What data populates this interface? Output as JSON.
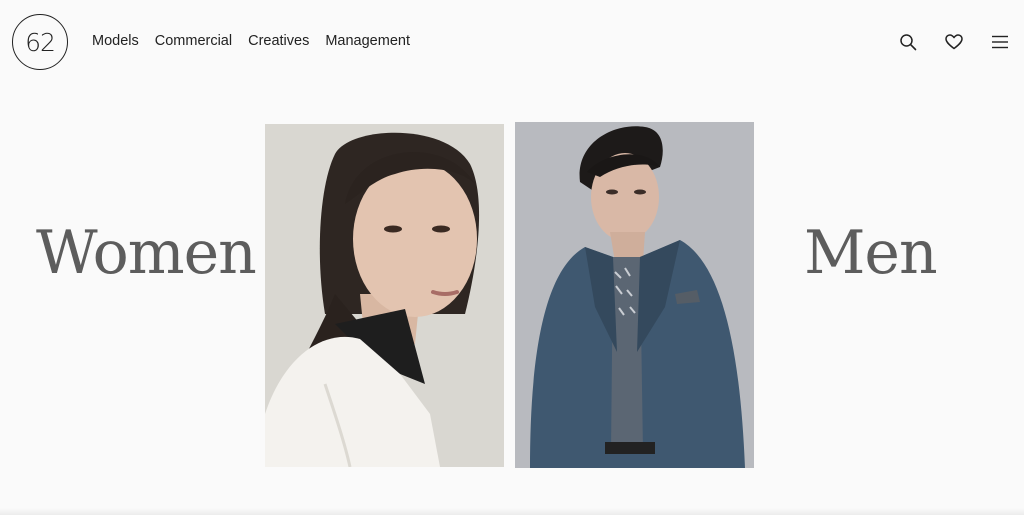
{
  "header": {
    "logo_text": "62",
    "nav": [
      {
        "label": "Models"
      },
      {
        "label": "Commercial"
      },
      {
        "label": "Creatives"
      },
      {
        "label": "Management"
      }
    ],
    "icons": [
      "search-icon",
      "heart-icon",
      "menu-icon"
    ]
  },
  "categories": {
    "women": {
      "label": "Women",
      "photo": "woman-portrait"
    },
    "men": {
      "label": "Men",
      "photo": "man-portrait"
    }
  },
  "colors": {
    "background": "#fafafa",
    "text": "#222222",
    "heading": "#5d5d5d"
  }
}
